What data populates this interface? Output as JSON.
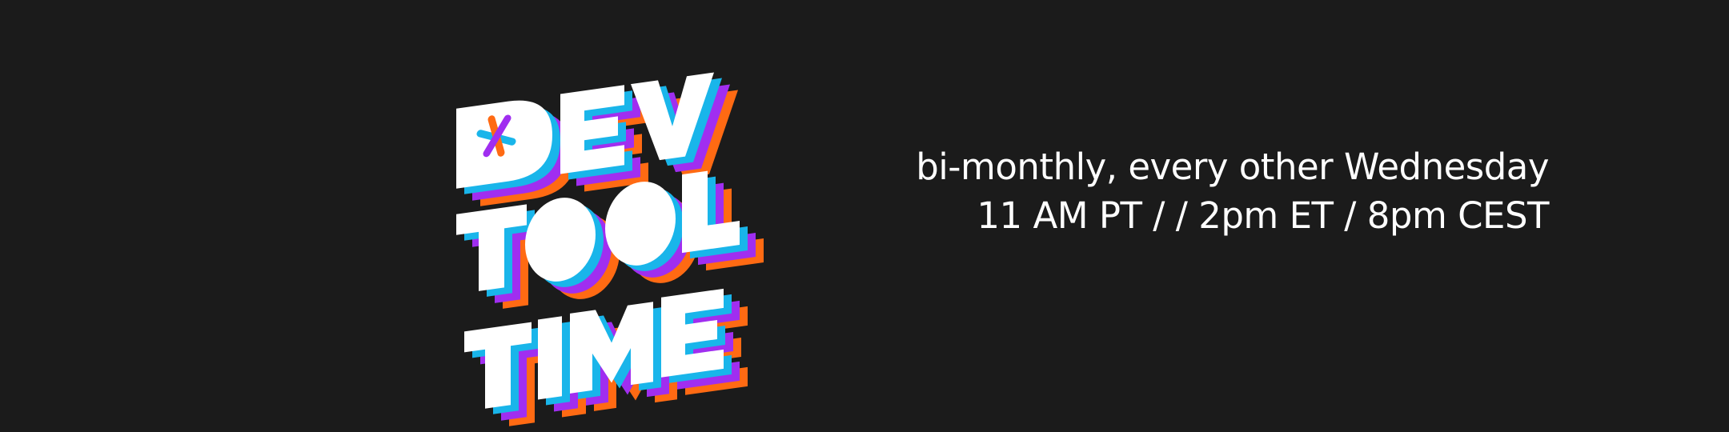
{
  "logo": {
    "alt_text": "DEV TOOL TIME",
    "colors": {
      "face": "#ffffff",
      "layer_cyan": "#19b5ea",
      "layer_purple": "#a02ef0",
      "layer_orange": "#ff6a13",
      "background": "#1b1b1b"
    },
    "icon": "cross-mark-icon"
  },
  "schedule": {
    "line1": "bi-monthly, every other Wednesday",
    "line2": "11 AM PT / / 2pm ET / 8pm CEST"
  }
}
